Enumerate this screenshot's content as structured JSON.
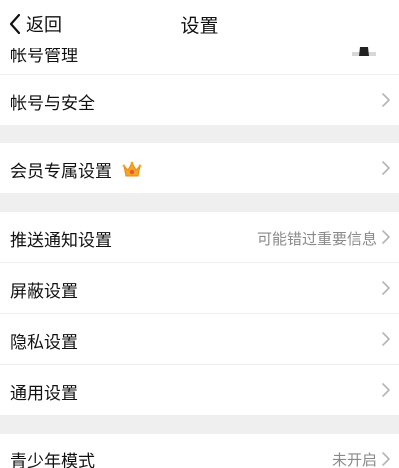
{
  "nav": {
    "back_label": "返回",
    "title": "设置"
  },
  "partial_row": {
    "label": "帐号管理"
  },
  "groups": [
    {
      "items": [
        {
          "label": "帐号与安全",
          "value": ""
        }
      ]
    },
    {
      "items": [
        {
          "label": "会员专属设置",
          "value": "",
          "icon": "crown-icon"
        }
      ]
    },
    {
      "items": [
        {
          "label": "推送通知设置",
          "value": "可能错过重要信息"
        },
        {
          "label": "屏蔽设置",
          "value": ""
        },
        {
          "label": "隐私设置",
          "value": ""
        },
        {
          "label": "通用设置",
          "value": ""
        }
      ]
    },
    {
      "items": [
        {
          "label": "青少年模式",
          "value": "未开启"
        }
      ]
    }
  ],
  "colors": {
    "background": "#ffffff",
    "separator": "#efefef",
    "text": "#111111",
    "secondary_text": "#8a8a8a",
    "chevron": "#b5b5b5",
    "crown": "#f5a623"
  }
}
